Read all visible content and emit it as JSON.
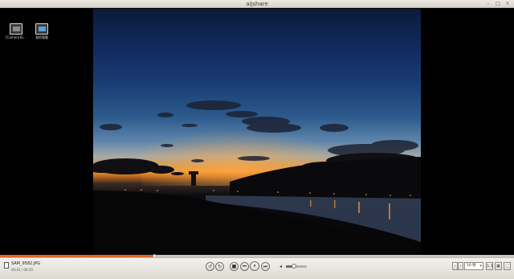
{
  "window": {
    "title": "aijshare",
    "controls": {
      "minimize": "–",
      "maximize": "□",
      "close": "×"
    }
  },
  "desktop_icons": [
    {
      "label": "[Camera]G...",
      "icon": "camera-icon"
    },
    {
      "label": "我的電腦",
      "icon": "computer-icon"
    }
  ],
  "media": {
    "filename": "SAM_9582.JPG",
    "counter": "00:01 / 00:10",
    "progress": 0.3
  },
  "playback": {
    "rotate_left": "↺",
    "rotate_right": "↻",
    "stop": "■",
    "previous": "⏮",
    "pause": "⏸",
    "next": "⏭"
  },
  "volume": {
    "icon": "◂",
    "level": 0.4
  },
  "view": {
    "prev": "‹",
    "next": "›",
    "ratio": "1:1",
    "zoom": "10 秒",
    "grid": "▦",
    "fullscreen": "⛶"
  },
  "colors": {
    "accent": "#e0662b",
    "bar_bg": "#ebe9e2"
  }
}
